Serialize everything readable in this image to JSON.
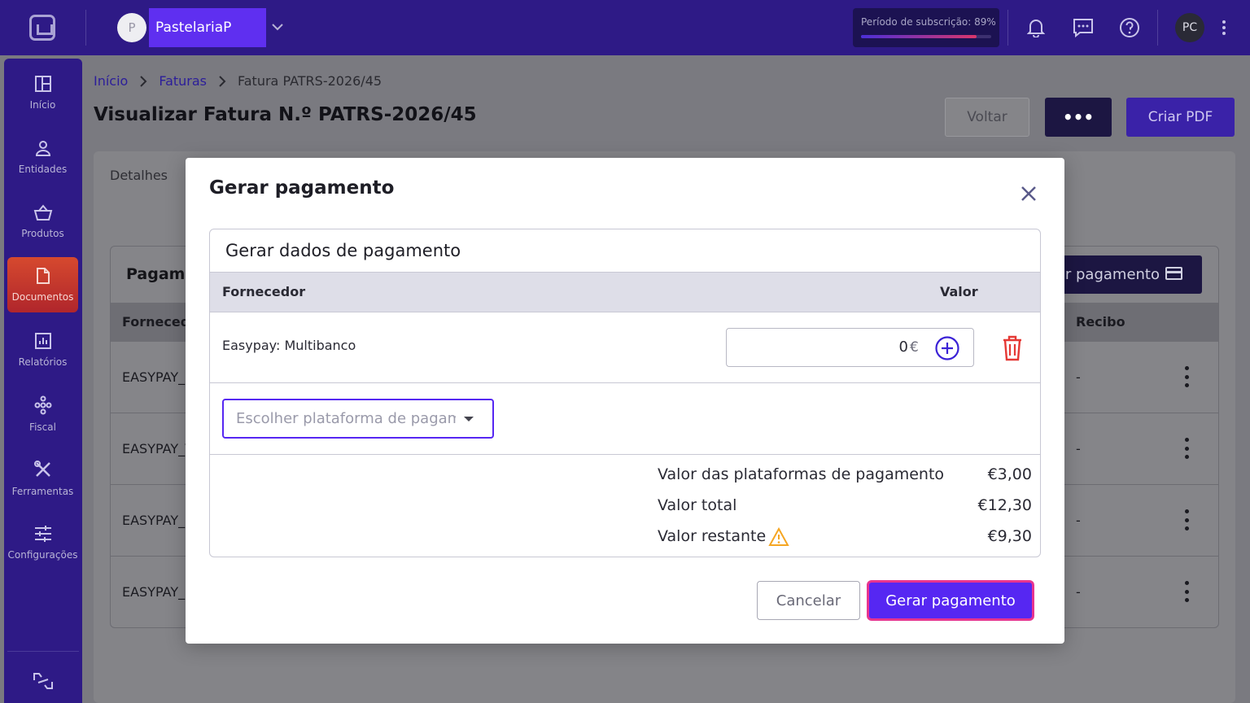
{
  "topbar": {
    "company_initial": "P",
    "company_name": "PastelariaP",
    "subscription_label": "Período de subscrição: 89%",
    "subscription_percent": 89,
    "user_initials": "PC"
  },
  "sidebar": {
    "items": [
      {
        "label": "Início",
        "icon": "dashboard-icon"
      },
      {
        "label": "Entidades",
        "icon": "user-icon"
      },
      {
        "label": "Produtos",
        "icon": "basket-icon"
      },
      {
        "label": "Documentos",
        "icon": "document-icon",
        "active": true
      },
      {
        "label": "Relatórios",
        "icon": "chart-icon"
      },
      {
        "label": "Fiscal",
        "icon": "hierarchy-icon"
      },
      {
        "label": "Ferramentas",
        "icon": "tools-icon"
      },
      {
        "label": "Configurações",
        "icon": "sliders-icon"
      }
    ]
  },
  "breadcrumb": {
    "home": "Início",
    "invoices": "Faturas",
    "current": "Fatura PATRS-2026/45"
  },
  "page": {
    "title": "Visualizar Fatura N.º PATRS-2026/45",
    "back_label": "Voltar",
    "more_label": "•••",
    "create_pdf_label": "Criar PDF",
    "details_tab": "Detalhes"
  },
  "payments_card": {
    "title": "Pagame",
    "generate_label": "r pagamento",
    "col_provider": "Fornecedo",
    "col_receipt": "Recibo",
    "rows": [
      {
        "provider": "EASYPAY_I",
        "receipt": "-"
      },
      {
        "provider": "EASYPAY_V",
        "receipt": "-"
      },
      {
        "provider": "EASYPAY_I",
        "receipt": "-"
      },
      {
        "provider": "EASYPAY_I",
        "receipt": "-"
      }
    ]
  },
  "modal": {
    "title": "Gerar pagamento",
    "section_title": "Gerar dados de pagamento",
    "col_provider": "Fornecedor",
    "col_value": "Valor",
    "payment_row": {
      "provider": "Easypay: Multibanco",
      "amount": "0",
      "currency": "€"
    },
    "platform_select_placeholder": "Escolher plataforma de pagamento",
    "summary": {
      "platforms_label": "Valor das plataformas de pagamento",
      "platforms_value": "€3,00",
      "total_label": "Valor total",
      "total_value": "€12,30",
      "remaining_label": "Valor restante",
      "remaining_value": "€9,30"
    },
    "cancel_label": "Cancelar",
    "generate_label": "Gerar pagamento"
  },
  "colors": {
    "brand": "#2e1a86",
    "accent": "#5627f2",
    "danger": "#e53935",
    "warning": "#f5a623",
    "focus_ring": "#e8358f"
  }
}
